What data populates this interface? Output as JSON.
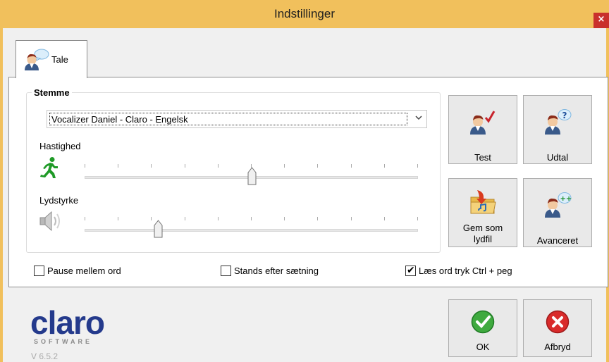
{
  "window": {
    "title": "Indstillinger",
    "close_glyph": "×"
  },
  "tabs": [
    {
      "label": "Tale",
      "icon": "speaker-person-icon"
    }
  ],
  "voice_group": {
    "label": "Stemme",
    "voice_select": {
      "value": "Vocalizer Daniel - Claro - Engelsk"
    },
    "speed": {
      "label": "Hastighed",
      "icon": "running-man-icon",
      "value": 0.5
    },
    "volume": {
      "label": "Lydstyrke",
      "icon": "speaker-icon",
      "value": 0.22
    }
  },
  "side_buttons": {
    "test": {
      "label": "Test",
      "icon": "person-check-icon"
    },
    "pronounce": {
      "label": "Udtal",
      "icon": "person-question-icon"
    },
    "save_audio": {
      "label_line1": "Gem som",
      "label_line2": "lydfil",
      "icon": "folder-save-icon"
    },
    "advanced": {
      "label": "Avanceret",
      "icon": "person-plus-icon"
    }
  },
  "options": {
    "pause_between_words": {
      "label": "Pause mellem ord",
      "checked": false
    },
    "stop_after_sentence": {
      "label": "Stands efter sætning",
      "checked": false
    },
    "read_word_ctrl": {
      "label": "Læs ord tryk Ctrl + peg",
      "checked": true,
      "mark": "✔"
    }
  },
  "footer": {
    "logo_text": "claro",
    "logo_sub": "SOFTWARE",
    "version": "V 6.5.2",
    "ok": {
      "label": "OK",
      "icon": "green-check-circle-icon"
    },
    "cancel": {
      "label": "Afbryd",
      "icon": "red-x-circle-icon"
    }
  },
  "colors": {
    "title_bar": "#f1c05c",
    "close": "#c9302c",
    "logo": "#243a8c"
  }
}
